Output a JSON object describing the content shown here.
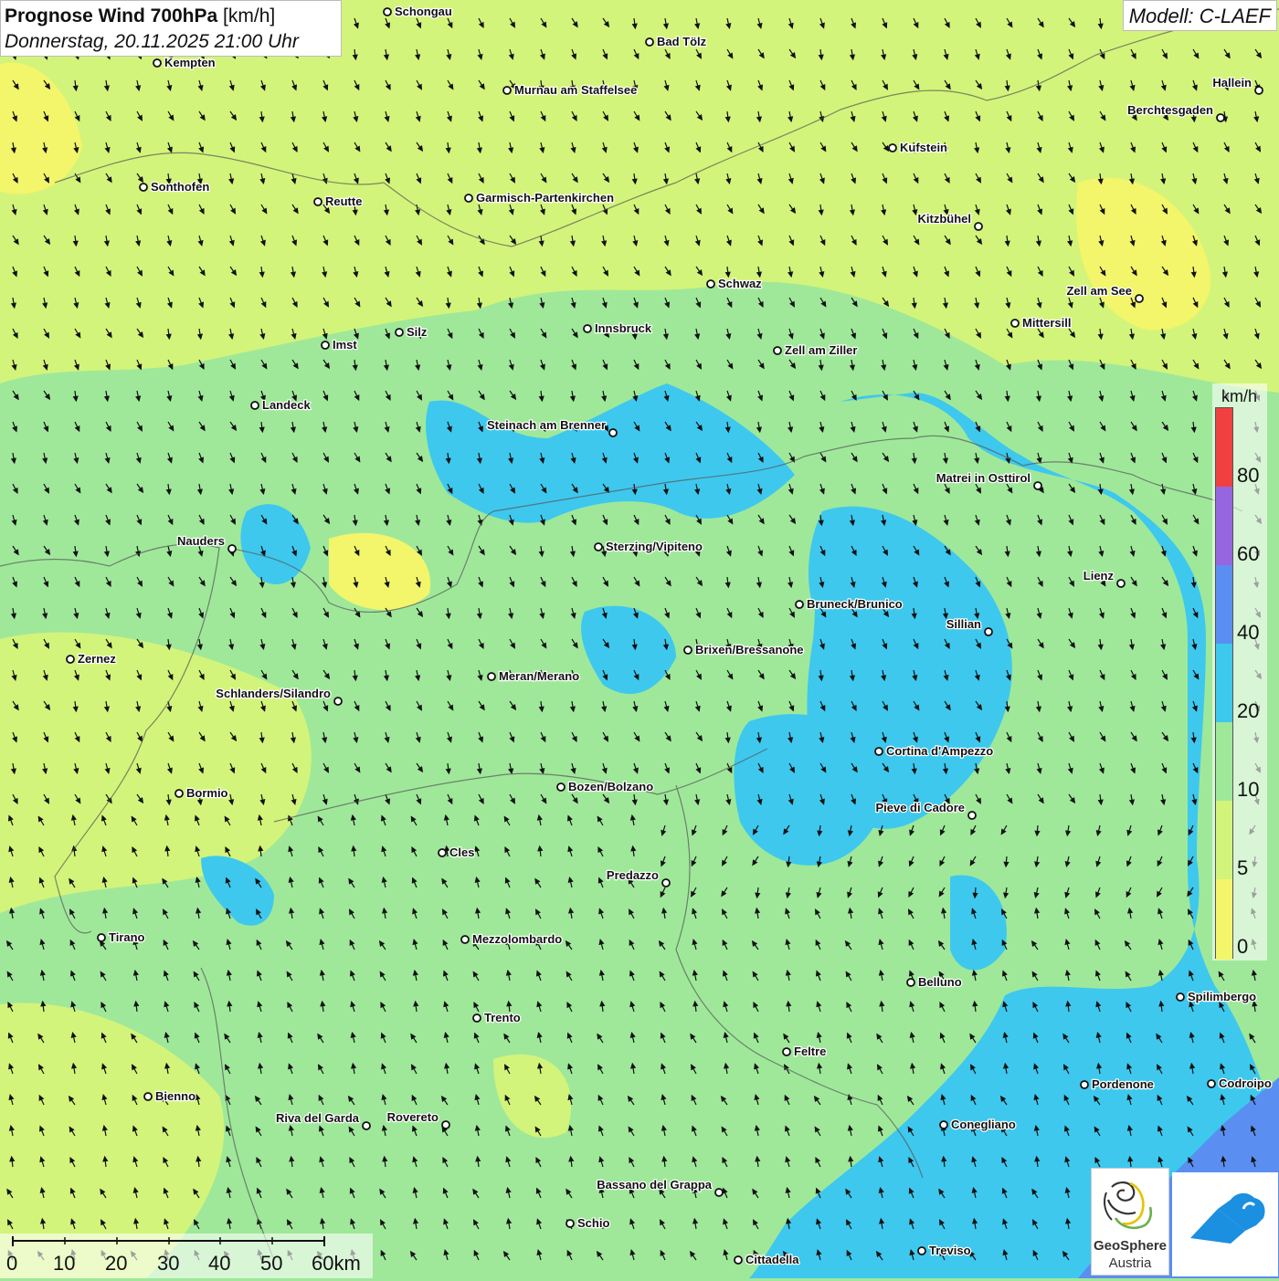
{
  "header": {
    "title": "Prognose Wind 700hPa",
    "unit": "[km/h]",
    "date": "Donnerstag, 20.11.2025 21:00 Uhr",
    "model": "Modell: C-LAEF"
  },
  "colors": {
    "level_0_5": "#f3f56a",
    "level_5_10": "#d3f47a",
    "level_10_20": "#9fe89a",
    "level_20_40": "#3ec8ee",
    "level_40_60": "#5a8ef0",
    "level_60_80": "#9666e0",
    "level_80_plus": "#f04040"
  },
  "legend": {
    "unit": "km/h",
    "labels": [
      "80",
      "60",
      "40",
      "20",
      "10",
      "5",
      "0"
    ]
  },
  "scale": {
    "labels": [
      "0",
      "10",
      "20",
      "30",
      "40",
      "50",
      "60km"
    ]
  },
  "logos": {
    "geosphere_line1": "GeoSphere",
    "geosphere_line2": "Austria",
    "geosphere_icon": "geosphere-swirl-icon",
    "weather_icon": "cloud-arrow-icon"
  },
  "cities": [
    {
      "name": "Schongau",
      "pos": "label-right"
    },
    {
      "name": "Bad Tölz",
      "pos": "label-right"
    },
    {
      "name": "Kempten",
      "pos": "label-right"
    },
    {
      "name": "Murnau am Staffelsee",
      "pos": "label-right"
    },
    {
      "name": "Hallein",
      "pos": "label-left"
    },
    {
      "name": "Berchtesgaden",
      "pos": "label-left"
    },
    {
      "name": "Kufstein",
      "pos": "label-right"
    },
    {
      "name": "Sonthofen",
      "pos": "label-right"
    },
    {
      "name": "Reutte",
      "pos": "label-right"
    },
    {
      "name": "Garmisch-Partenkirchen",
      "pos": "label-right"
    },
    {
      "name": "Kitzbühel",
      "pos": "label-left"
    },
    {
      "name": "Schwaz",
      "pos": "label-right"
    },
    {
      "name": "Zell am See",
      "pos": "label-left"
    },
    {
      "name": "Mittersill",
      "pos": "label-right"
    },
    {
      "name": "Innsbruck",
      "pos": "label-right"
    },
    {
      "name": "Silz",
      "pos": "label-right"
    },
    {
      "name": "Imst",
      "pos": "label-right"
    },
    {
      "name": "Zell am Ziller",
      "pos": "label-right"
    },
    {
      "name": "Landeck",
      "pos": "label-right"
    },
    {
      "name": "Steinach am Brenner",
      "pos": "label-left"
    },
    {
      "name": "Matrei in Osttirol",
      "pos": "label-left"
    },
    {
      "name": "Nauders",
      "pos": "label-left"
    },
    {
      "name": "Sterzing/Vipiteno",
      "pos": "label-right"
    },
    {
      "name": "Lienz",
      "pos": "label-left"
    },
    {
      "name": "Bruneck/Brunico",
      "pos": "label-right"
    },
    {
      "name": "Sillian",
      "pos": "label-left"
    },
    {
      "name": "Zernez",
      "pos": "label-right"
    },
    {
      "name": "Brixen/Bressanone",
      "pos": "label-right"
    },
    {
      "name": "Meran/Merano",
      "pos": "label-right"
    },
    {
      "name": "Schlanders/Silandro",
      "pos": "label-left"
    },
    {
      "name": "Cortina d'Ampezzo",
      "pos": "label-right"
    },
    {
      "name": "Bozen/Bolzano",
      "pos": "label-right"
    },
    {
      "name": "Bormio",
      "pos": "label-right"
    },
    {
      "name": "Pieve di Cadore",
      "pos": "label-left"
    },
    {
      "name": "Cles",
      "pos": "label-right"
    },
    {
      "name": "Predazzo",
      "pos": "label-left"
    },
    {
      "name": "Tirano",
      "pos": "label-right"
    },
    {
      "name": "Mezzolombardo",
      "pos": "label-right"
    },
    {
      "name": "Belluno",
      "pos": "label-right"
    },
    {
      "name": "Spilimbergo",
      "pos": "label-right"
    },
    {
      "name": "Trento",
      "pos": "label-right"
    },
    {
      "name": "Feltre",
      "pos": "label-right"
    },
    {
      "name": "Pordenone",
      "pos": "label-right"
    },
    {
      "name": "Codroipo",
      "pos": "label-right"
    },
    {
      "name": "Bienno",
      "pos": "label-right"
    },
    {
      "name": "Riva del Garda",
      "pos": "label-left"
    },
    {
      "name": "Rovereto",
      "pos": "label-left"
    },
    {
      "name": "Conegliano",
      "pos": "label-right"
    },
    {
      "name": "Bassano del Grappa",
      "pos": "label-left"
    },
    {
      "name": "Schio",
      "pos": "label-right"
    },
    {
      "name": "Treviso",
      "pos": "label-right"
    },
    {
      "name": "Cittadella",
      "pos": "label-right"
    }
  ]
}
